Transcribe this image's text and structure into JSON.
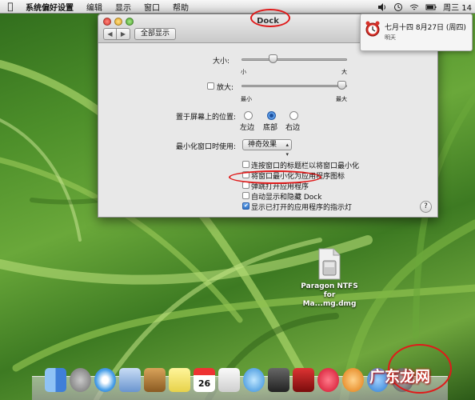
{
  "menubar": {
    "app_name": "系统偏好设置",
    "items": [
      "编辑",
      "显示",
      "窗口",
      "帮助"
    ],
    "clock": "周三 14"
  },
  "window": {
    "title": "Dock",
    "show_all": "全部显示",
    "size_label": "大小:",
    "size_min": "小",
    "size_max": "大",
    "size_value": 0.28,
    "magnify_label": "放大:",
    "magnify_min": "最小",
    "magnify_max": "最大",
    "magnify_value": 1.0,
    "position_label": "置于屏幕上的位置:",
    "positions": [
      "左边",
      "底部",
      "右边"
    ],
    "position_selected": "底部",
    "minimize_label": "最小化窗口时使用:",
    "minimize_effect": "神奇效果",
    "options": [
      {
        "label": "连按窗口的标题栏以将窗口最小化",
        "checked": false
      },
      {
        "label": "将窗口最小化为应用程序图标",
        "checked": false
      },
      {
        "label": "弹跳打开应用程序",
        "checked": false
      },
      {
        "label": "自动显示和隐藏 Dock",
        "checked": false
      },
      {
        "label": "显示已打开的应用程序的指示灯",
        "checked": true
      }
    ],
    "help": "?"
  },
  "notification": {
    "line1": "七月十四 8月27日 (周四)",
    "line2": "明天"
  },
  "desktop_file": {
    "line1": "Paragon NTFS",
    "line2": "for Ma...mg.dmg"
  },
  "watermark": "广东龙网",
  "colors": {
    "highlight_circle": "#e01a1a",
    "accent": "#3c7fd2"
  }
}
